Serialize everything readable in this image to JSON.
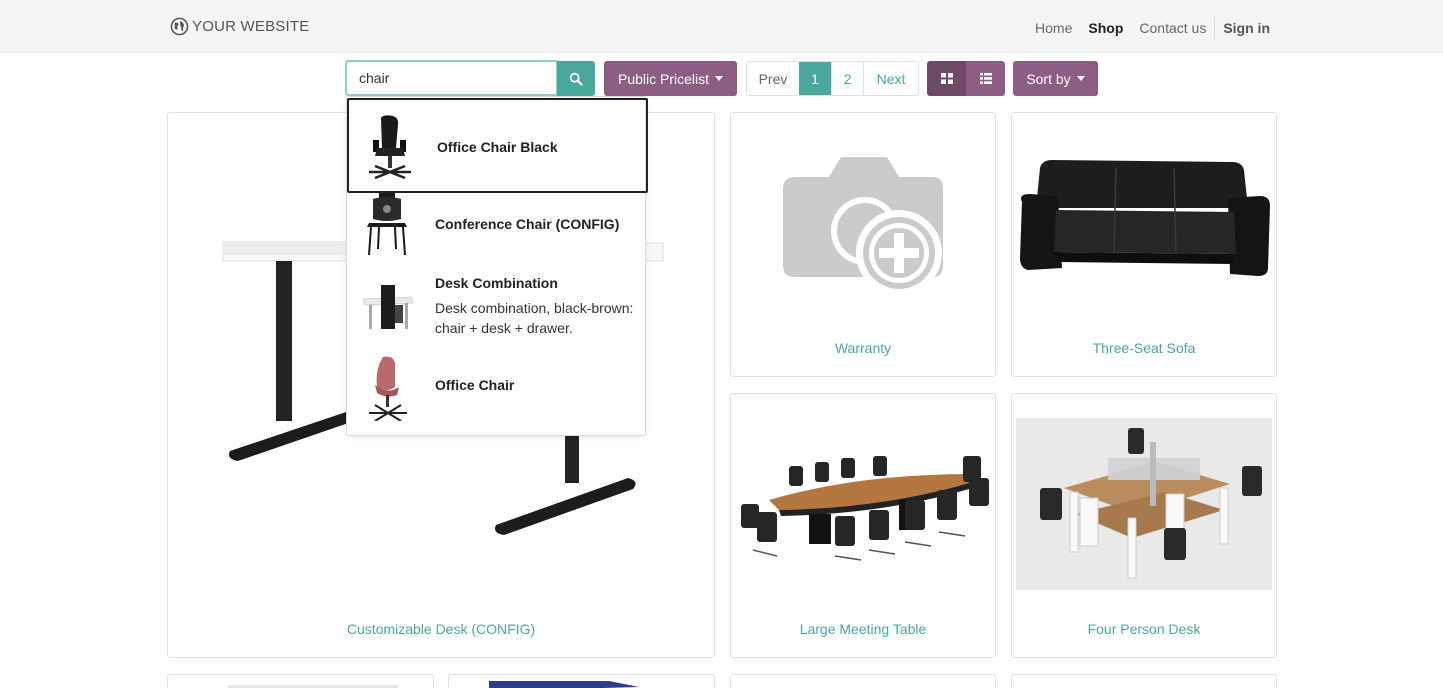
{
  "header": {
    "logo_text": "YOUR WEBSITE",
    "nav": {
      "home": "Home",
      "shop": "Shop",
      "contact": "Contact us",
      "signin": "Sign in"
    }
  },
  "toolbar": {
    "search_value": "chair",
    "pricelist_label": "Public Pricelist",
    "pager": {
      "prev": "Prev",
      "page1": "1",
      "page2": "2",
      "next": "Next"
    },
    "sort_label": "Sort by"
  },
  "autocomplete": {
    "items": [
      {
        "title": "Office Chair Black",
        "description": ""
      },
      {
        "title": "Conference Chair (CONFIG)",
        "description": ""
      },
      {
        "title": "Desk Combination",
        "description": "Desk combination, black-brown: chair + desk + drawer."
      },
      {
        "title": "Office Chair",
        "description": ""
      }
    ]
  },
  "products": {
    "desk": "Customizable Desk (CONFIG)",
    "warranty": "Warranty",
    "sofa": "Three-Seat Sofa",
    "meeting": "Large Meeting Table",
    "fourdesk": "Four Person Desk"
  },
  "colors": {
    "accent": "#4ba89f",
    "brand": "#8d5d86",
    "brand_dark": "#6e4868"
  },
  "icons": [
    "globe-icon",
    "search-icon",
    "grid-view-icon",
    "list-view-icon",
    "caret-down-icon"
  ]
}
